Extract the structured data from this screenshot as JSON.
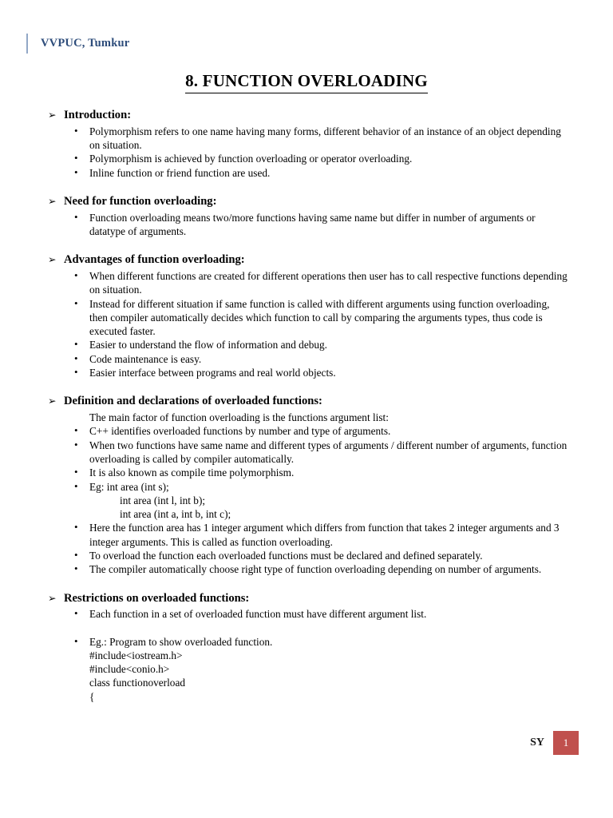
{
  "header": {
    "title": "VVPUC, Tumkur",
    "rule_color": "#92A8C6",
    "text_color": "#2E4D7B"
  },
  "title": "8. FUNCTION OVERLOADING",
  "bullet_glyphs": {
    "section_arrow": "➢",
    "item_dot": "•"
  },
  "sections": [
    {
      "heading": "Introduction:",
      "items": [
        "Polymorphism refers to one name having many forms, different behavior of an instance of an object depending on situation.",
        "Polymorphism is achieved by function overloading or operator overloading.",
        "Inline function or friend function are used."
      ]
    },
    {
      "heading": "Need for function overloading:",
      "items": [
        "Function overloading means two/more functions having same name but differ in number of arguments or datatype of arguments."
      ]
    },
    {
      "heading": "Advantages of function overloading:",
      "items": [
        "When different functions are created for different operations then user has to call respective functions depending on situation.",
        "Instead for different situation if same function is called with different arguments using function overloading, then compiler automatically decides which function to call by comparing the arguments types, thus code is executed faster.",
        "Easier to understand the flow of information and debug.",
        "Code maintenance is easy.",
        "Easier interface between programs and real world objects."
      ]
    },
    {
      "heading": "Definition and declarations of overloaded functions:",
      "lead_line": "The main factor of function overloading is the functions argument list:",
      "items": [
        "C++ identifies overloaded functions by number and type of arguments.",
        "When two functions have same name and different types of arguments / different number of arguments, function overloading is called by compiler automatically.",
        "It is also known as compile time polymorphism."
      ],
      "example_item": {
        "first_line": "Eg: int area (int s);",
        "continuation_lines": [
          "int area (int l, int b);",
          "int area (int a, int b, int c);"
        ]
      },
      "items_after": [
        "Here the function area has 1 integer argument which differs from function that takes 2 integer arguments and 3 integer arguments. This is called as function overloading.",
        "To overload the function each overloaded functions must be declared and defined separately.",
        "The compiler automatically choose right type of function overloading depending on number of arguments."
      ]
    },
    {
      "heading": "Restrictions on overloaded functions:",
      "items": [
        "Each function in a set of overloaded function must have different argument list."
      ],
      "program_item": {
        "first_line": "Eg.: Program to show overloaded function.",
        "code_lines": [
          "#include<iostream.h>",
          "#include<conio.h>",
          "class functionoverload",
          "{"
        ]
      }
    }
  ],
  "footer": {
    "label": "SY",
    "page_number": "1",
    "badge_color": "#C0504D"
  }
}
